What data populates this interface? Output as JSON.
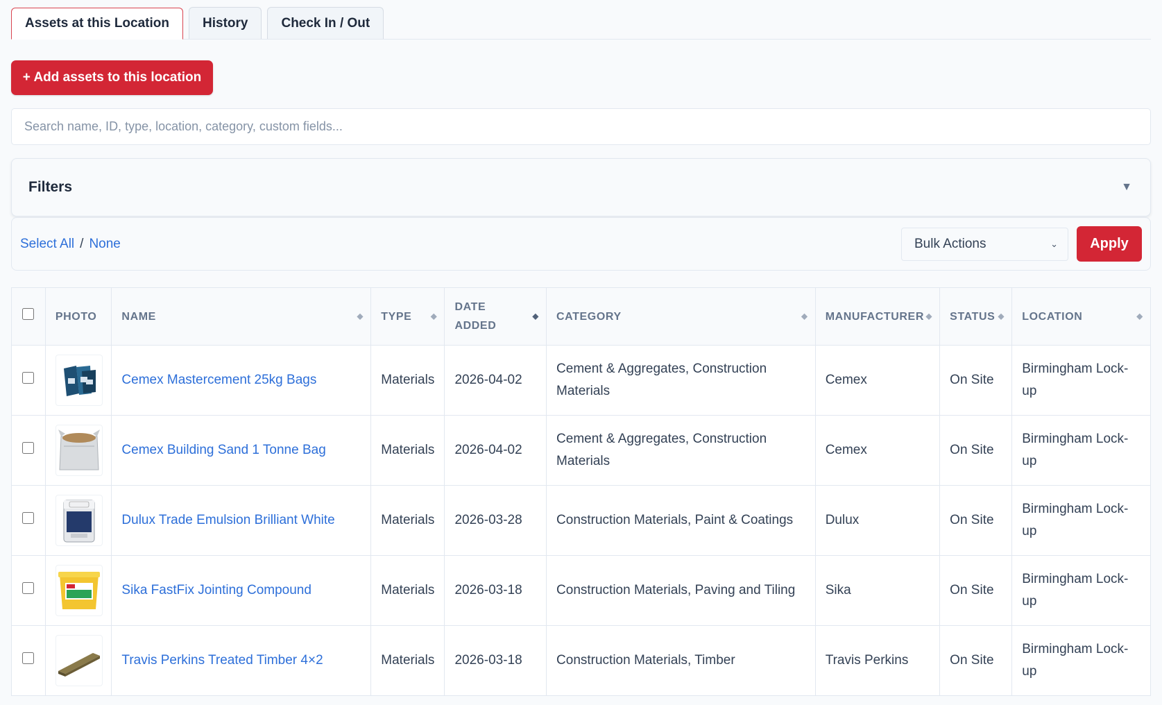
{
  "tabs": [
    {
      "label": "Assets at this Location",
      "active": true
    },
    {
      "label": "History",
      "active": false
    },
    {
      "label": "Check In / Out",
      "active": false
    }
  ],
  "add_button": "+ Add assets to this location",
  "search": {
    "placeholder": "Search name, ID, type, location, category, custom fields...",
    "value": ""
  },
  "filters": {
    "title": "Filters",
    "caret": "▼"
  },
  "bulk": {
    "select_all": "Select All",
    "separator": "/",
    "none": "None",
    "selected": "Bulk Actions",
    "apply": "Apply"
  },
  "table": {
    "headers": [
      "PHOTO",
      "NAME",
      "TYPE",
      "DATE",
      "ADDED",
      "CATEGORY",
      "MANUFACTURER",
      "STATUS",
      "LOCATION"
    ],
    "rows": [
      {
        "photo_icon": "cement-bags-photo",
        "name": "Cemex Mastercement 25kg Bags",
        "type": "Materials",
        "date": "2026-04-02",
        "category": "Cement & Aggregates, Construction Materials",
        "manufacturer": "Cemex",
        "status": "On Site",
        "location": "Birmingham Lock-up"
      },
      {
        "photo_icon": "sand-bag-photo",
        "name": "Cemex Building Sand 1 Tonne Bag",
        "type": "Materials",
        "date": "2026-04-02",
        "category": "Cement & Aggregates, Construction Materials",
        "manufacturer": "Cemex",
        "status": "On Site",
        "location": "Birmingham Lock-up"
      },
      {
        "photo_icon": "paint-tin-photo",
        "name": "Dulux Trade Emulsion Brilliant White",
        "type": "Materials",
        "date": "2026-03-28",
        "category": "Construction Materials, Paint & Coatings",
        "manufacturer": "Dulux",
        "status": "On Site",
        "location": "Birmingham Lock-up"
      },
      {
        "photo_icon": "compound-tub-photo",
        "name": "Sika FastFix Jointing Compound",
        "type": "Materials",
        "date": "2026-03-18",
        "category": "Construction Materials, Paving and Tiling",
        "manufacturer": "Sika",
        "status": "On Site",
        "location": "Birmingham Lock-up"
      },
      {
        "photo_icon": "timber-photo",
        "name": "Travis Perkins Treated Timber 4×2",
        "type": "Materials",
        "date": "2026-03-18",
        "category": "Construction Materials, Timber",
        "manufacturer": "Travis Perkins",
        "status": "On Site",
        "location": "Birmingham Lock-up"
      }
    ]
  },
  "colors": {
    "accent": "#d32635",
    "link": "#2d6fd9"
  }
}
